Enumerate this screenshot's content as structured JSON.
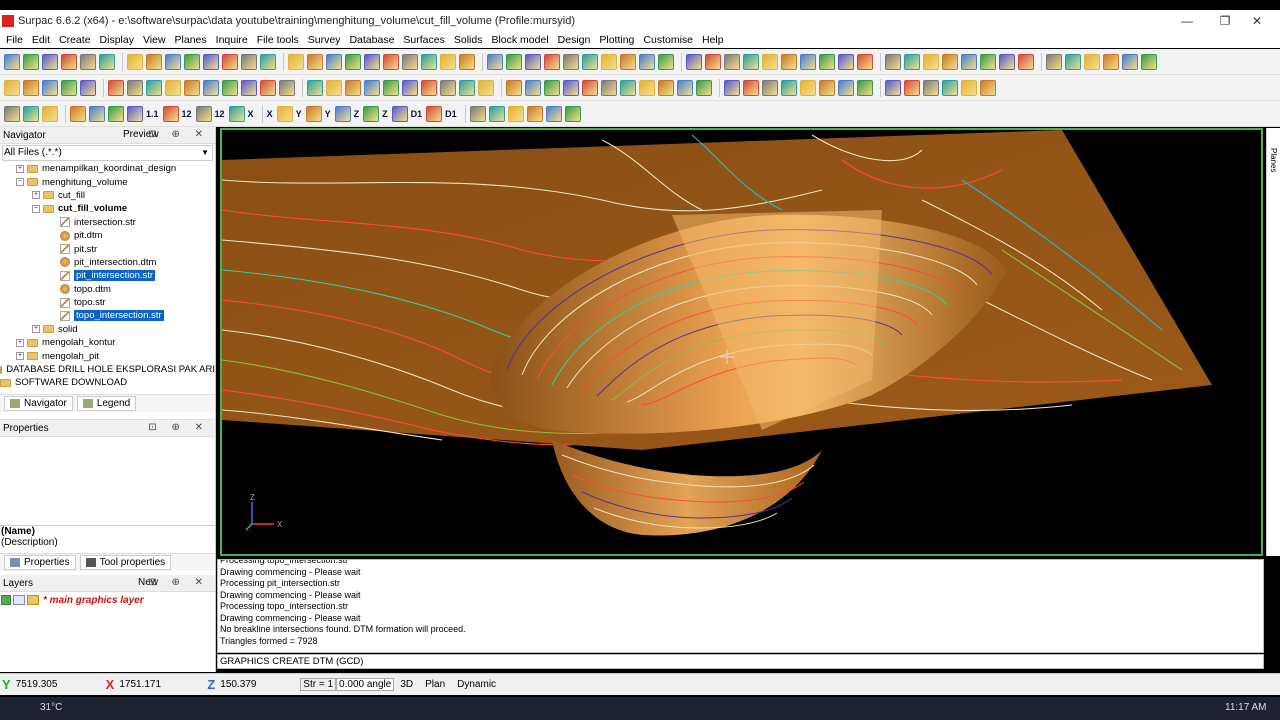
{
  "window": {
    "title": "Surpac 6.6.2 (x64) - e:\\software\\surpac\\data youtube\\training\\menghitung_volume\\cut_fill_volume (Profile:mursyid)",
    "minimize": "—",
    "maximize": "❐",
    "close": "✕"
  },
  "menu": [
    "File",
    "Edit",
    "Create",
    "Display",
    "View",
    "Planes",
    "Inquire",
    "File tools",
    "Survey",
    "Database",
    "Surfaces",
    "Solids",
    "Block model",
    "Design",
    "Plotting",
    "Customise",
    "Help"
  ],
  "toolbar3_labels": [
    "1.1",
    "12",
    "12",
    "X",
    "X",
    "Y",
    "Y",
    "Z",
    "Z",
    "D1",
    "D1"
  ],
  "navigator": {
    "title": "Navigator",
    "preview": "Preview",
    "controls": "⊡ ⊕ ✕",
    "filter": "All Files (.*.*)",
    "tree": [
      {
        "label": "menampilkan_koordinat_design",
        "indent": 1,
        "type": "folder",
        "exp": "+"
      },
      {
        "label": "menghitung_volume",
        "indent": 1,
        "type": "folder",
        "exp": "−"
      },
      {
        "label": "cut_fill",
        "indent": 2,
        "type": "folder",
        "exp": "+"
      },
      {
        "label": "cut_fill_volume",
        "indent": 2,
        "type": "folder",
        "exp": "−",
        "bold": true
      },
      {
        "label": "intersection.str",
        "indent": 3,
        "type": "str"
      },
      {
        "label": "pit.dtm",
        "indent": 3,
        "type": "dtm"
      },
      {
        "label": "pit.str",
        "indent": 3,
        "type": "str"
      },
      {
        "label": "pit_intersection.dtm",
        "indent": 3,
        "type": "dtm"
      },
      {
        "label": "pit_intersection.str",
        "indent": 3,
        "type": "str",
        "selected": true
      },
      {
        "label": "topo.dtm",
        "indent": 3,
        "type": "dtm"
      },
      {
        "label": "topo.str",
        "indent": 3,
        "type": "str"
      },
      {
        "label": "topo_intersection.str",
        "indent": 3,
        "type": "str",
        "selected": true
      },
      {
        "label": "solid",
        "indent": 2,
        "type": "folder",
        "exp": "+"
      },
      {
        "label": "mengolah_kontur",
        "indent": 1,
        "type": "folder",
        "exp": "+"
      },
      {
        "label": "mengolah_pit",
        "indent": 1,
        "type": "folder",
        "exp": "+"
      },
      {
        "label": "DATABASE DRILL HOLE EKSPLORASI PAK ARI",
        "indent": 0,
        "type": "folder"
      },
      {
        "label": "SOFTWARE DOWNLOAD",
        "indent": 0,
        "type": "folder"
      }
    ],
    "tabs": [
      "Navigator",
      "Legend"
    ]
  },
  "properties": {
    "title": "Properties",
    "controls": "⊡ ⊕ ✕",
    "name": "(Name)",
    "description": "(Description)",
    "tabs": [
      "Properties",
      "Tool properties"
    ]
  },
  "layers": {
    "title": "Layers",
    "new": "New",
    "controls": "⊡ ⊕ ✕",
    "items": [
      "* main graphics layer"
    ]
  },
  "planes_tab": "Planes",
  "axis": {
    "z": "Z",
    "x": "X"
  },
  "console": {
    "lines": [
      "Processing topo_intersection.str",
      "Drawing commencing - Please wait",
      "Processing pit_intersection.str",
      "Drawing commencing - Please wait",
      "Processing topo_intersection.str",
      "Drawing commencing - Please wait",
      "No breakline intersections found. DTM formation will proceed.",
      "Triangles formed = 7928"
    ],
    "command": "GRAPHICS CREATE DTM (GCD)"
  },
  "status": {
    "y_label": "Y",
    "y": "7519.305",
    "x_label": "X",
    "x": "1751.171",
    "z_label": "Z",
    "z": "150.379",
    "str": "Str = 1",
    "angle": "0.000 angle",
    "mode3d": "3D",
    "plan": "Plan",
    "dynamic": "Dynamic"
  },
  "taskbar": {
    "temp": "31°C",
    "time": "11:17 AM"
  },
  "colors": {
    "accent": "#4caf50",
    "selection": "#0a64c8",
    "surface": "#a8641c",
    "layer_text": "#d01010"
  }
}
